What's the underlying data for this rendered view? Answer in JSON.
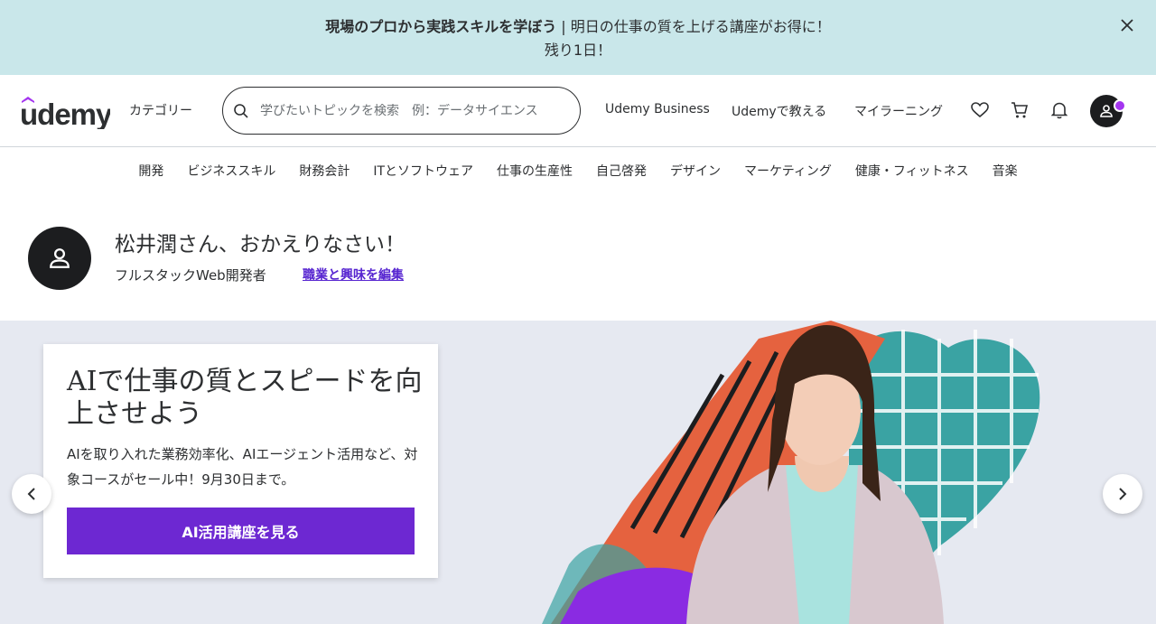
{
  "promo": {
    "headline": "現場のプロから実践スキルを学ぼう",
    "separator": " | ",
    "message": "明日の仕事の質を上げる講座がお得に！",
    "line2": "残り1日！",
    "close_icon": "close-icon"
  },
  "header": {
    "logo": "udemy",
    "categories_label": "カテゴリー",
    "search_placeholder": "学びたいトピックを検索　例：データサイエンス",
    "business_label": "Udemy Business",
    "teach_label": "Udemyで教える",
    "my_learning_label": "マイラーニング",
    "icons": [
      "search-icon",
      "heart-icon",
      "cart-icon",
      "bell-icon",
      "user-icon"
    ],
    "accent_color": "#a435f0"
  },
  "category_nav": {
    "items": [
      "開発",
      "ビジネススキル",
      "財務会計",
      "ITとソフトウェア",
      "仕事の生産性",
      "自己啓発",
      "デザイン",
      "マーケティング",
      "健康・フィットネス",
      "音楽"
    ]
  },
  "welcome": {
    "greeting": "松井潤さん、おかえりなさい！",
    "occupation": "フルスタックWeb開発者",
    "edit_link": "職業と興味を編集"
  },
  "hero": {
    "title": "AIで仕事の質とスピードを向上させよう",
    "description": "AIを取り入れた業務効率化、AIエージェント活用など、対象コースがセール中！9月30日まで。",
    "cta_label": "AI活用講座を見る",
    "cta_color": "#6d28d2",
    "prev_icon": "chevron-left-icon",
    "next_icon": "chevron-right-icon"
  }
}
